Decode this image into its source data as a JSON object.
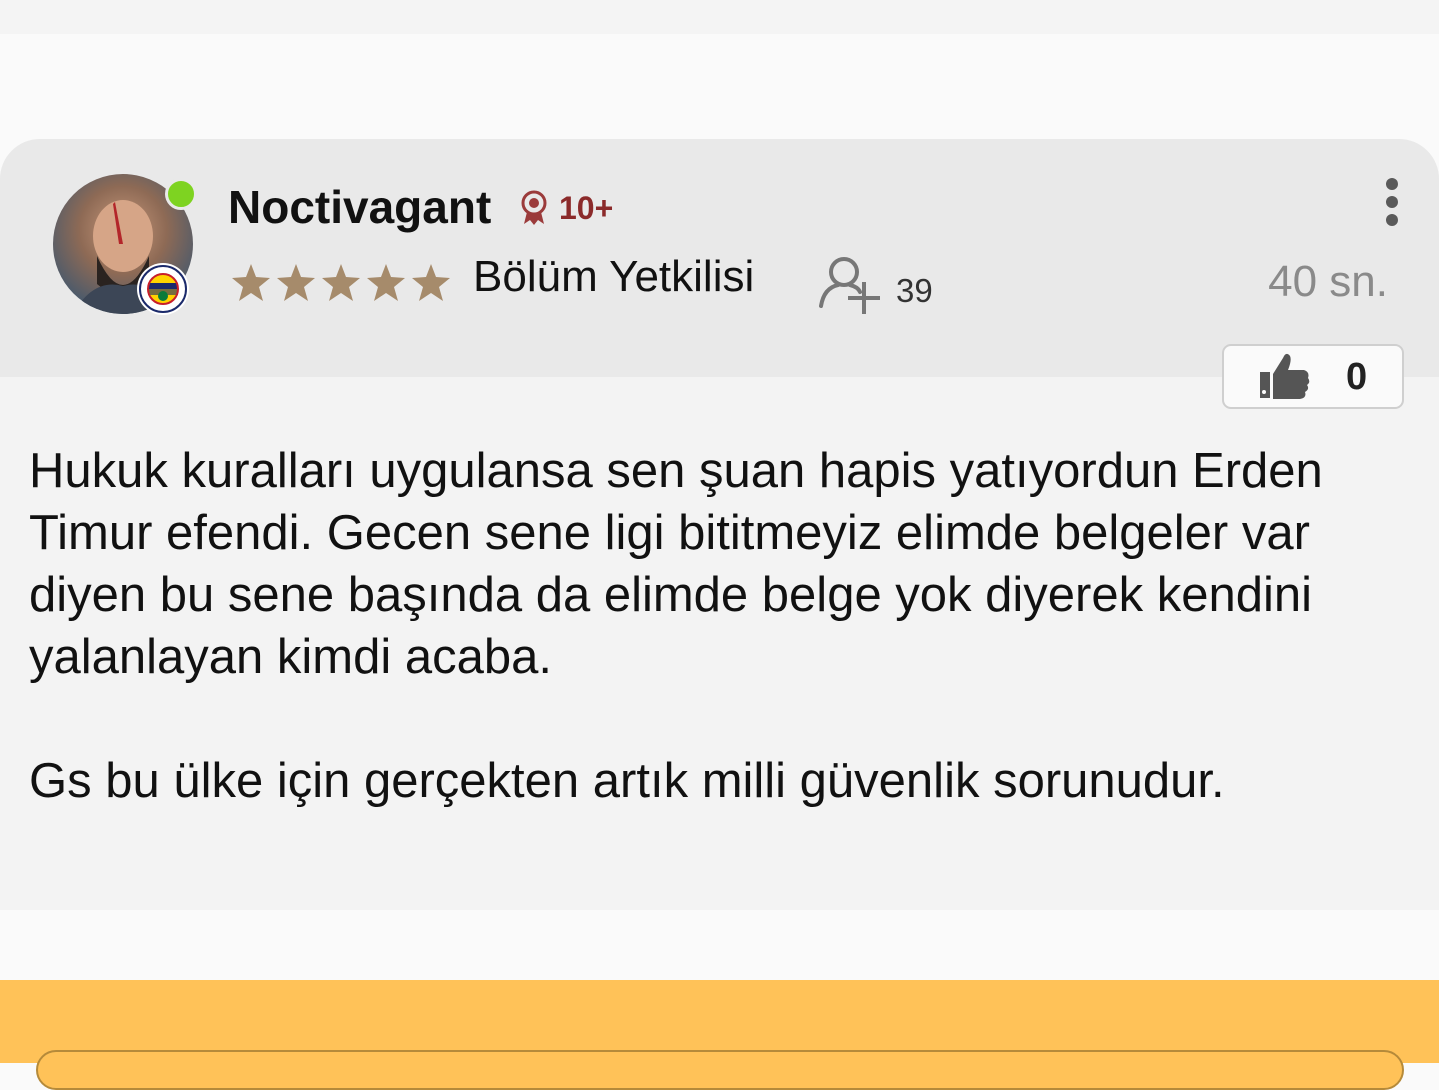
{
  "comment": {
    "username": "Noctivagant",
    "rank_badge": "10+",
    "star_rating": 5,
    "role": "Bölüm Yetkilisi",
    "follower_count": "39",
    "timestamp": "40 sn.",
    "like_count": "0",
    "paragraphs": [
      "Hukuk kuralları uygulansa sen şuan hapis yatıyordun Erden Timur efendi. Gecen sene ligi bititmeyiz elimde belgeler var diyen bu sene başında da elimde belge yok diyerek kendini yalanlayan kimdi acaba.",
      "Gs bu ülke için gerçekten artık milli güvenlik sorunudur."
    ]
  },
  "icons": {
    "online_status": "online-dot",
    "rank": "rank-ribbon-icon",
    "follow": "add-user-icon",
    "menu": "more-vertical-icon",
    "like": "thumbs-up-icon",
    "team": "team-badge-icon"
  },
  "colors": {
    "header_bg": "#e9e9e9",
    "body_bg": "#f3f3f3",
    "online": "#7ed321",
    "rank": "#8b2a2a",
    "star": "#a68b6b",
    "footer": "#ffc258"
  }
}
